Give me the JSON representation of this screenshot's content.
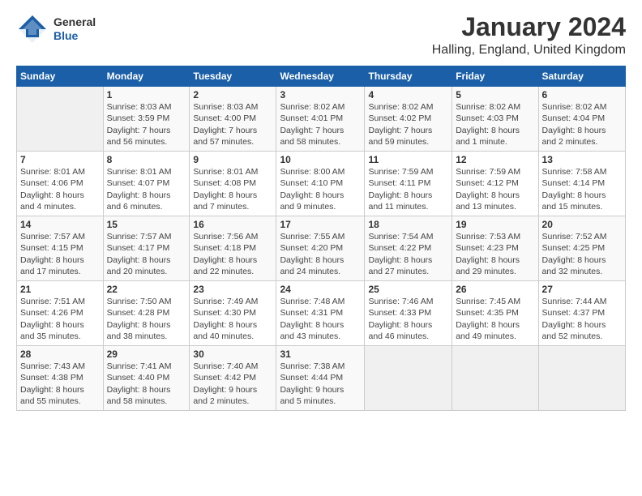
{
  "header": {
    "logo_line1": "General",
    "logo_line2": "Blue",
    "title": "January 2024",
    "subtitle": "Halling, England, United Kingdom"
  },
  "weekdays": [
    "Sunday",
    "Monday",
    "Tuesday",
    "Wednesday",
    "Thursday",
    "Friday",
    "Saturday"
  ],
  "weeks": [
    [
      {
        "day": "",
        "info": ""
      },
      {
        "day": "1",
        "info": "Sunrise: 8:03 AM\nSunset: 3:59 PM\nDaylight: 7 hours\nand 56 minutes."
      },
      {
        "day": "2",
        "info": "Sunrise: 8:03 AM\nSunset: 4:00 PM\nDaylight: 7 hours\nand 57 minutes."
      },
      {
        "day": "3",
        "info": "Sunrise: 8:02 AM\nSunset: 4:01 PM\nDaylight: 7 hours\nand 58 minutes."
      },
      {
        "day": "4",
        "info": "Sunrise: 8:02 AM\nSunset: 4:02 PM\nDaylight: 7 hours\nand 59 minutes."
      },
      {
        "day": "5",
        "info": "Sunrise: 8:02 AM\nSunset: 4:03 PM\nDaylight: 8 hours\nand 1 minute."
      },
      {
        "day": "6",
        "info": "Sunrise: 8:02 AM\nSunset: 4:04 PM\nDaylight: 8 hours\nand 2 minutes."
      }
    ],
    [
      {
        "day": "7",
        "info": "Sunrise: 8:01 AM\nSunset: 4:06 PM\nDaylight: 8 hours\nand 4 minutes."
      },
      {
        "day": "8",
        "info": "Sunrise: 8:01 AM\nSunset: 4:07 PM\nDaylight: 8 hours\nand 6 minutes."
      },
      {
        "day": "9",
        "info": "Sunrise: 8:01 AM\nSunset: 4:08 PM\nDaylight: 8 hours\nand 7 minutes."
      },
      {
        "day": "10",
        "info": "Sunrise: 8:00 AM\nSunset: 4:10 PM\nDaylight: 8 hours\nand 9 minutes."
      },
      {
        "day": "11",
        "info": "Sunrise: 7:59 AM\nSunset: 4:11 PM\nDaylight: 8 hours\nand 11 minutes."
      },
      {
        "day": "12",
        "info": "Sunrise: 7:59 AM\nSunset: 4:12 PM\nDaylight: 8 hours\nand 13 minutes."
      },
      {
        "day": "13",
        "info": "Sunrise: 7:58 AM\nSunset: 4:14 PM\nDaylight: 8 hours\nand 15 minutes."
      }
    ],
    [
      {
        "day": "14",
        "info": "Sunrise: 7:57 AM\nSunset: 4:15 PM\nDaylight: 8 hours\nand 17 minutes."
      },
      {
        "day": "15",
        "info": "Sunrise: 7:57 AM\nSunset: 4:17 PM\nDaylight: 8 hours\nand 20 minutes."
      },
      {
        "day": "16",
        "info": "Sunrise: 7:56 AM\nSunset: 4:18 PM\nDaylight: 8 hours\nand 22 minutes."
      },
      {
        "day": "17",
        "info": "Sunrise: 7:55 AM\nSunset: 4:20 PM\nDaylight: 8 hours\nand 24 minutes."
      },
      {
        "day": "18",
        "info": "Sunrise: 7:54 AM\nSunset: 4:22 PM\nDaylight: 8 hours\nand 27 minutes."
      },
      {
        "day": "19",
        "info": "Sunrise: 7:53 AM\nSunset: 4:23 PM\nDaylight: 8 hours\nand 29 minutes."
      },
      {
        "day": "20",
        "info": "Sunrise: 7:52 AM\nSunset: 4:25 PM\nDaylight: 8 hours\nand 32 minutes."
      }
    ],
    [
      {
        "day": "21",
        "info": "Sunrise: 7:51 AM\nSunset: 4:26 PM\nDaylight: 8 hours\nand 35 minutes."
      },
      {
        "day": "22",
        "info": "Sunrise: 7:50 AM\nSunset: 4:28 PM\nDaylight: 8 hours\nand 38 minutes."
      },
      {
        "day": "23",
        "info": "Sunrise: 7:49 AM\nSunset: 4:30 PM\nDaylight: 8 hours\nand 40 minutes."
      },
      {
        "day": "24",
        "info": "Sunrise: 7:48 AM\nSunset: 4:31 PM\nDaylight: 8 hours\nand 43 minutes."
      },
      {
        "day": "25",
        "info": "Sunrise: 7:46 AM\nSunset: 4:33 PM\nDaylight: 8 hours\nand 46 minutes."
      },
      {
        "day": "26",
        "info": "Sunrise: 7:45 AM\nSunset: 4:35 PM\nDaylight: 8 hours\nand 49 minutes."
      },
      {
        "day": "27",
        "info": "Sunrise: 7:44 AM\nSunset: 4:37 PM\nDaylight: 8 hours\nand 52 minutes."
      }
    ],
    [
      {
        "day": "28",
        "info": "Sunrise: 7:43 AM\nSunset: 4:38 PM\nDaylight: 8 hours\nand 55 minutes."
      },
      {
        "day": "29",
        "info": "Sunrise: 7:41 AM\nSunset: 4:40 PM\nDaylight: 8 hours\nand 58 minutes."
      },
      {
        "day": "30",
        "info": "Sunrise: 7:40 AM\nSunset: 4:42 PM\nDaylight: 9 hours\nand 2 minutes."
      },
      {
        "day": "31",
        "info": "Sunrise: 7:38 AM\nSunset: 4:44 PM\nDaylight: 9 hours\nand 5 minutes."
      },
      {
        "day": "",
        "info": ""
      },
      {
        "day": "",
        "info": ""
      },
      {
        "day": "",
        "info": ""
      }
    ]
  ]
}
